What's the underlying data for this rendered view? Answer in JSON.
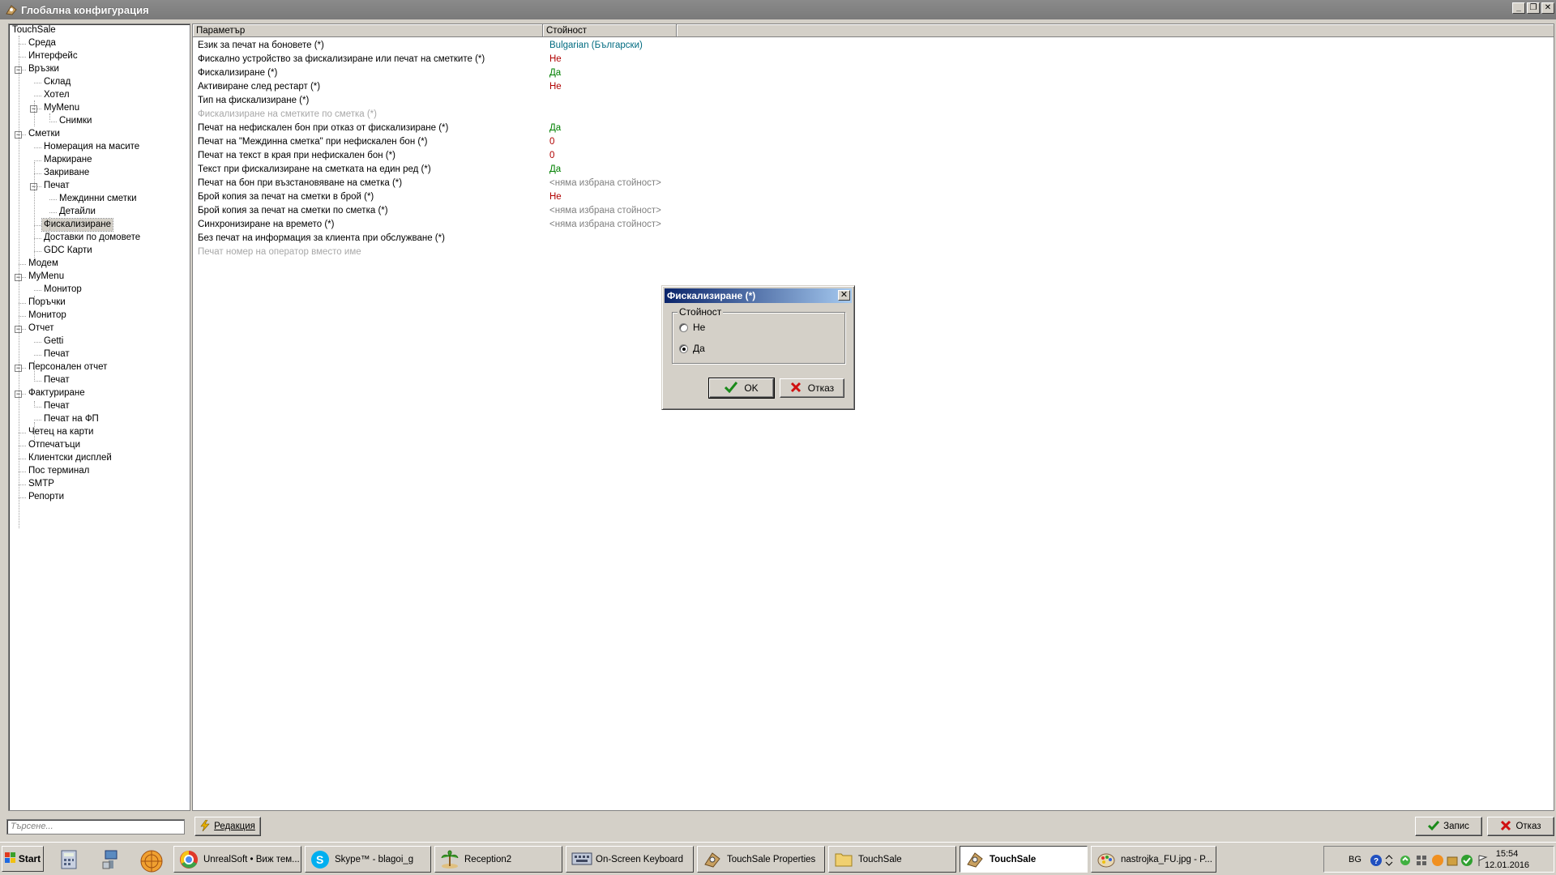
{
  "window": {
    "title": "Глобална конфигурация"
  },
  "tree": [
    {
      "label": "TouchSale"
    },
    {
      "label": "Среда"
    },
    {
      "label": "Интерфейс"
    },
    {
      "label": "Връзки"
    },
    {
      "label": "Склад"
    },
    {
      "label": "Хотел"
    },
    {
      "label": "MyMenu"
    },
    {
      "label": "Снимки"
    },
    {
      "label": "Сметки"
    },
    {
      "label": "Номерация на масите"
    },
    {
      "label": "Маркиране"
    },
    {
      "label": "Закриване"
    },
    {
      "label": "Печат"
    },
    {
      "label": "Междинни сметки"
    },
    {
      "label": "Детайли"
    },
    {
      "label": "Фискализиране"
    },
    {
      "label": "Доставки по домовете"
    },
    {
      "label": "GDC Карти"
    },
    {
      "label": "Модем"
    },
    {
      "label": "MyMenu"
    },
    {
      "label": "Монитор"
    },
    {
      "label": "Поръчки"
    },
    {
      "label": "Монитор"
    },
    {
      "label": "Отчет"
    },
    {
      "label": "Getti"
    },
    {
      "label": "Печат"
    },
    {
      "label": "Персонален отчет"
    },
    {
      "label": "Печат"
    },
    {
      "label": "Фактуриране"
    },
    {
      "label": "Печат"
    },
    {
      "label": "Печат на ФП"
    },
    {
      "label": "Четец на карти"
    },
    {
      "label": "Отпечатъци"
    },
    {
      "label": "Клиентски дисплей"
    },
    {
      "label": "Пос терминал"
    },
    {
      "label": "SMTP"
    },
    {
      "label": "Репорти"
    }
  ],
  "grid": {
    "col_param": "Параметър",
    "col_value": "Стойност",
    "rows": [
      {
        "param": "Език за печат на боновете (*)",
        "value": "Bulgarian (Български)",
        "color": "#006b80"
      },
      {
        "param": "Фискално устройство за фискализиране или печат на сметките (*)",
        "value": "Не",
        "color": "#b00000"
      },
      {
        "param": "Фискализиране (*)",
        "value": "Да",
        "color": "#008000"
      },
      {
        "param": "Активиране след рестарт (*)",
        "value": "Не",
        "color": "#b00000"
      },
      {
        "param": "Тип на фискализиране (*)",
        "value": ""
      },
      {
        "param": "Фискализиране на сметките по сметка (*)",
        "value": "",
        "disabled": true
      },
      {
        "param": "Печат на нефискален бон при отказ от фискализиране (*)",
        "value": "Да",
        "color": "#008000"
      },
      {
        "param": "Печат на \"Междинна сметка\" при нефискален бон (*)",
        "value": "0",
        "color": "#b00000"
      },
      {
        "param": "Печат на текст в края при нефискален бон (*)",
        "value": "0",
        "color": "#b00000"
      },
      {
        "param": "Текст при фискализиране на сметката на един ред (*)",
        "value": "Да",
        "color": "#008000"
      },
      {
        "param": "Печат на бон при възстановяване на сметка (*)",
        "value": "<няма избрана стойност>",
        "color": "#808080"
      },
      {
        "param": "Брой копия за печат на сметки в брой (*)",
        "value": "Не",
        "color": "#b00000"
      },
      {
        "param": "Брой копия за печат на сметки по сметка (*)",
        "value": "<няма избрана стойност>",
        "color": "#808080"
      },
      {
        "param": "Синхронизиране на времето (*)",
        "value": "<няма избрана стойност>",
        "color": "#808080"
      },
      {
        "param": "Без печат на информация за клиента при обслужване (*)",
        "value": ""
      },
      {
        "param": "Печат номер на оператор вместо име",
        "value": "",
        "disabled": true
      }
    ]
  },
  "bottom": {
    "search_placeholder": "Търсене...",
    "edit_label": "Редакция",
    "save_label": "Запис",
    "cancel_label": "Отказ"
  },
  "dialog": {
    "title": "Фискализиране (*)",
    "group_label": "Стойност",
    "options": [
      {
        "label": "Не",
        "checked": false
      },
      {
        "label": "Да",
        "checked": true
      }
    ],
    "ok_label": "OK",
    "cancel_label": "Отказ"
  },
  "taskbar": {
    "start_label": "Start",
    "tasks": [
      {
        "label": "UnrealSoft • Виж тем...",
        "icon": "chrome-icon"
      },
      {
        "label": "Skype™ - blagoi_g",
        "icon": "skype-icon"
      },
      {
        "label": "Reception2",
        "icon": "palm-icon"
      },
      {
        "label": "On-Screen Keyboard",
        "icon": "keyboard-icon"
      },
      {
        "label": "TouchSale Properties",
        "icon": "touchsale-icon"
      },
      {
        "label": "TouchSale",
        "icon": "folder-icon"
      },
      {
        "label": "TouchSale",
        "icon": "touchsale-icon",
        "active": true
      },
      {
        "label": "nastrojka_FU.jpg - P...",
        "icon": "paint-icon"
      }
    ],
    "lang": "BG",
    "time": "15:54",
    "date": "12.01.2016"
  }
}
